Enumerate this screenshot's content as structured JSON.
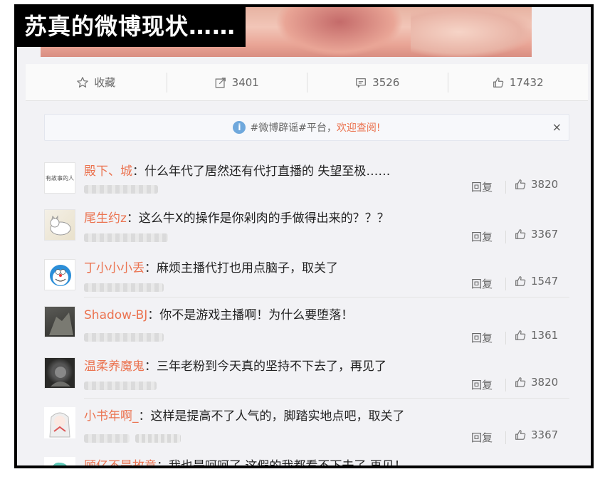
{
  "banner": {
    "title": "苏真的微博现状……"
  },
  "actions": [
    {
      "icon": "star-icon",
      "label": "收藏"
    },
    {
      "icon": "repost-icon",
      "label": "3401"
    },
    {
      "icon": "comment-icon",
      "label": "3526"
    },
    {
      "icon": "thumbs-up-icon",
      "label": "17432"
    }
  ],
  "notice": {
    "prefix": "#微博辟谣#平台，",
    "highlight": "欢迎查阅!",
    "close": "×"
  },
  "comments": [
    {
      "name": "殿下、城",
      "text": "：什么年代了居然还有代打直播的  失望至极……",
      "reply": "回复",
      "likes": "3820",
      "avatar_text": "有故事的人"
    },
    {
      "name": "尾生约z",
      "text": "：这么牛X的操作是你剁肉的手做得出来的？？？",
      "reply": "回复",
      "likes": "3367",
      "avatar_text": ""
    },
    {
      "name": "丁小小小丢",
      "text": "：麻烦主播代打也用点脑子，取关了",
      "reply": "回复",
      "likes": "1547",
      "avatar_text": ""
    },
    {
      "name": "Shadow-BJ",
      "text": "：你不是游戏主播啊！为什么要堕落！",
      "reply": "回复",
      "likes": "1361",
      "avatar_text": ""
    },
    {
      "name": "温柔养魔鬼",
      "text": "：三年老粉到今天真的坚持不下去了，再见了",
      "reply": "回复",
      "likes": "3820",
      "avatar_text": ""
    },
    {
      "name": "小书年啊_",
      "text": "：这样是提高不了人气的，脚踏实地点吧，取关了",
      "reply": "回复",
      "likes": "3367",
      "avatar_text": ""
    },
    {
      "name": "顾亿不是故意",
      "text": "：我也是呵呵了  这假的我都看不下去了  再见！",
      "reply": "",
      "likes": "",
      "avatar_text": ""
    }
  ]
}
